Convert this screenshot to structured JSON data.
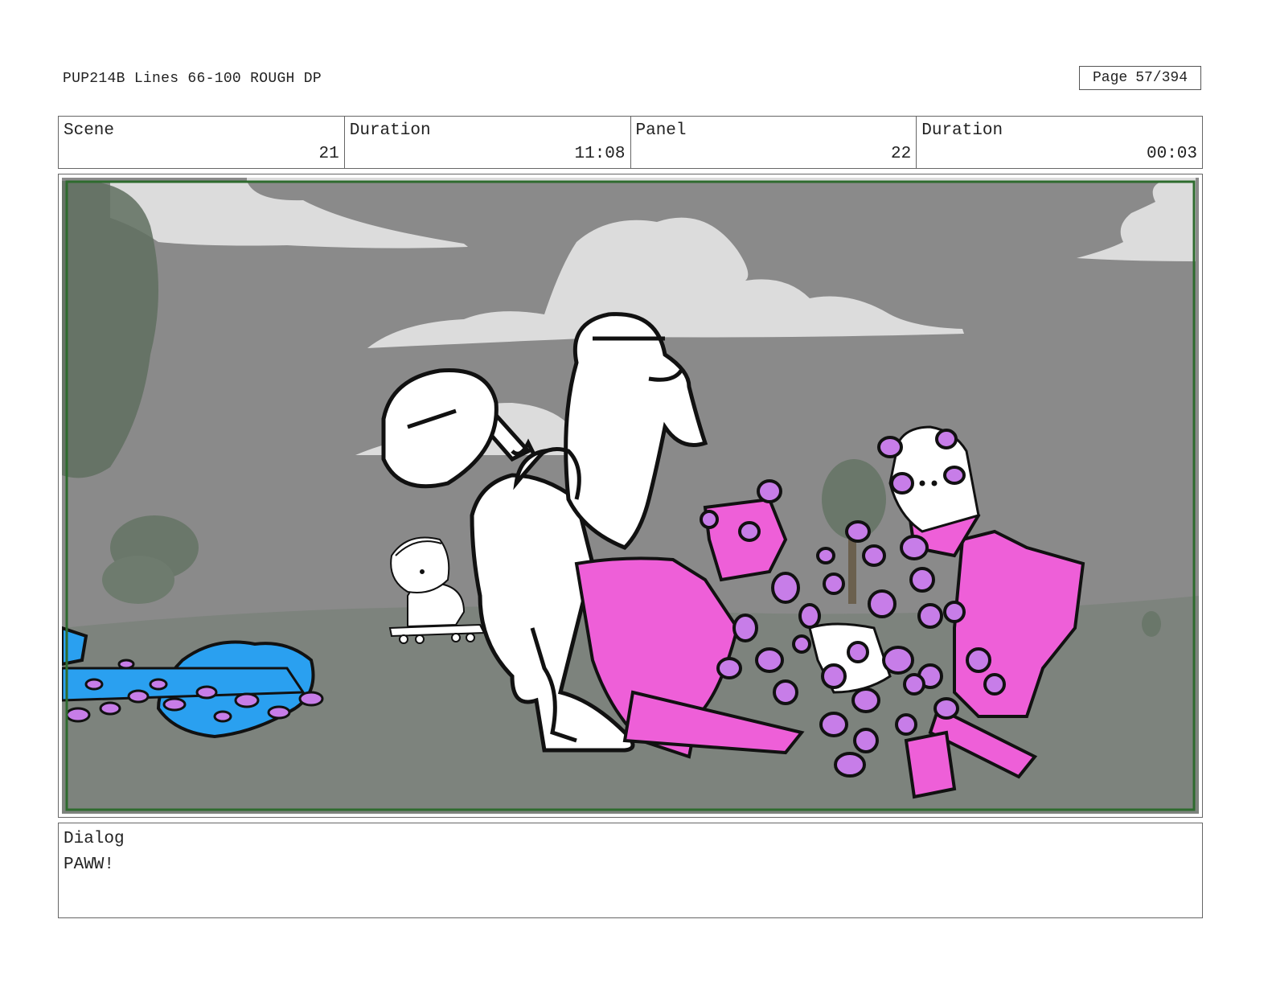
{
  "header": {
    "doc_title": "PUP214B Lines 66-100 ROUGH DP",
    "page_label": "Page",
    "page_number": "57/394"
  },
  "info": {
    "scene_label": "Scene",
    "scene_value": "21",
    "scene_duration_label": "Duration",
    "scene_duration_value": "11:08",
    "panel_label": "Panel",
    "panel_value": "22",
    "panel_duration_label": "Duration",
    "panel_duration_value": "00:03"
  },
  "dialog": {
    "label": "Dialog",
    "text": "PAWW!"
  },
  "colors": {
    "sky": "#8a8a8a",
    "ground": "#7e847e",
    "cloud": "#dcdcdc",
    "frame_border": "#2e6b2e",
    "pink": "#ee5fd8",
    "purple": "#c77de8",
    "blue": "#2aa0f0"
  }
}
